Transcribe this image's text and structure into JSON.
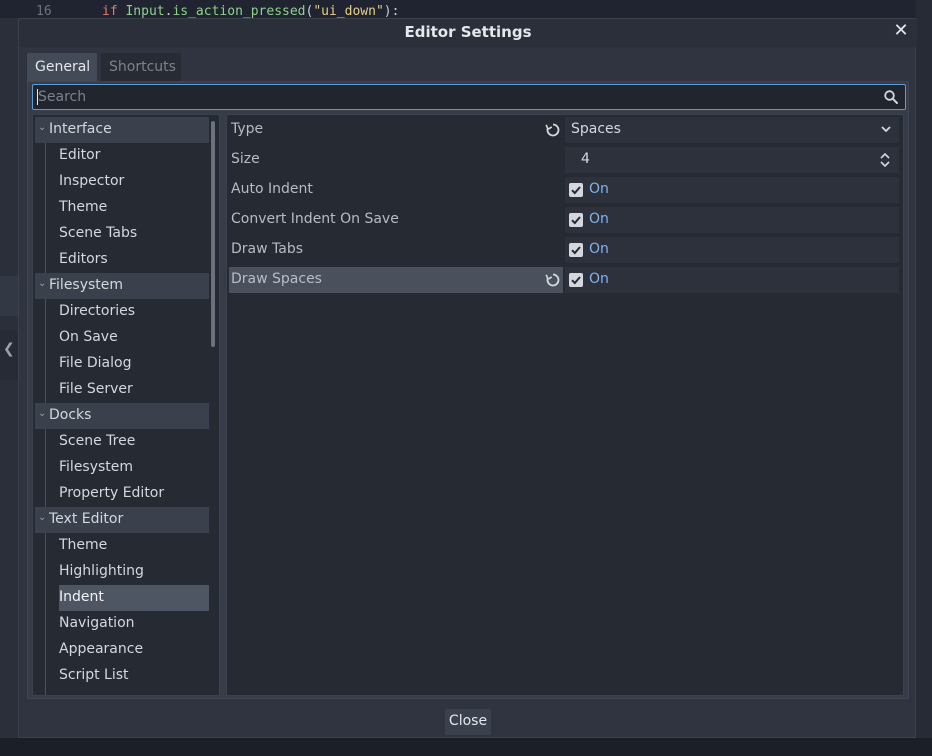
{
  "background": {
    "line_number": "16",
    "code_keyword": "if ",
    "code_obj": "Input",
    "code_dot": ".",
    "code_method": "is_action_pressed",
    "code_paren": "(",
    "code_string": "\"ui_down\"",
    "code_end": "):"
  },
  "dialog": {
    "title": "Editor Settings",
    "close_label": "Close",
    "tabs": [
      "General",
      "Shortcuts"
    ],
    "search": {
      "placeholder": "Search"
    }
  },
  "tree": {
    "items": [
      {
        "label": "Interface",
        "kind": "category"
      },
      {
        "label": "Editor",
        "kind": "leaf"
      },
      {
        "label": "Inspector",
        "kind": "leaf"
      },
      {
        "label": "Theme",
        "kind": "leaf"
      },
      {
        "label": "Scene Tabs",
        "kind": "leaf"
      },
      {
        "label": "Editors",
        "kind": "leaf"
      },
      {
        "label": "Filesystem",
        "kind": "category"
      },
      {
        "label": "Directories",
        "kind": "leaf"
      },
      {
        "label": "On Save",
        "kind": "leaf"
      },
      {
        "label": "File Dialog",
        "kind": "leaf"
      },
      {
        "label": "File Server",
        "kind": "leaf"
      },
      {
        "label": "Docks",
        "kind": "category"
      },
      {
        "label": "Scene Tree",
        "kind": "leaf"
      },
      {
        "label": "Filesystem",
        "kind": "leaf"
      },
      {
        "label": "Property Editor",
        "kind": "leaf"
      },
      {
        "label": "Text Editor",
        "kind": "category"
      },
      {
        "label": "Theme",
        "kind": "leaf"
      },
      {
        "label": "Highlighting",
        "kind": "leaf"
      },
      {
        "label": "Indent",
        "kind": "leaf",
        "selected": true
      },
      {
        "label": "Navigation",
        "kind": "leaf"
      },
      {
        "label": "Appearance",
        "kind": "leaf"
      },
      {
        "label": "Script List",
        "kind": "leaf"
      }
    ]
  },
  "properties": [
    {
      "label": "Type",
      "value": "Spaces",
      "editor": "dropdown",
      "revert": true
    },
    {
      "label": "Size",
      "value": "4",
      "editor": "spin"
    },
    {
      "label": "Auto Indent",
      "value": "On",
      "editor": "checkbox",
      "checked": true
    },
    {
      "label": "Convert Indent On Save",
      "value": "On",
      "editor": "checkbox",
      "checked": true
    },
    {
      "label": "Draw Tabs",
      "value": "On",
      "editor": "checkbox",
      "checked": true
    },
    {
      "label": "Draw Spaces",
      "value": "On",
      "editor": "checkbox",
      "checked": true,
      "revert": true,
      "highlighted": true
    }
  ],
  "colors": {
    "accent": "#5e9bd3",
    "on_text": "#7fb4ef",
    "dialog_bg": "#2f3440"
  }
}
